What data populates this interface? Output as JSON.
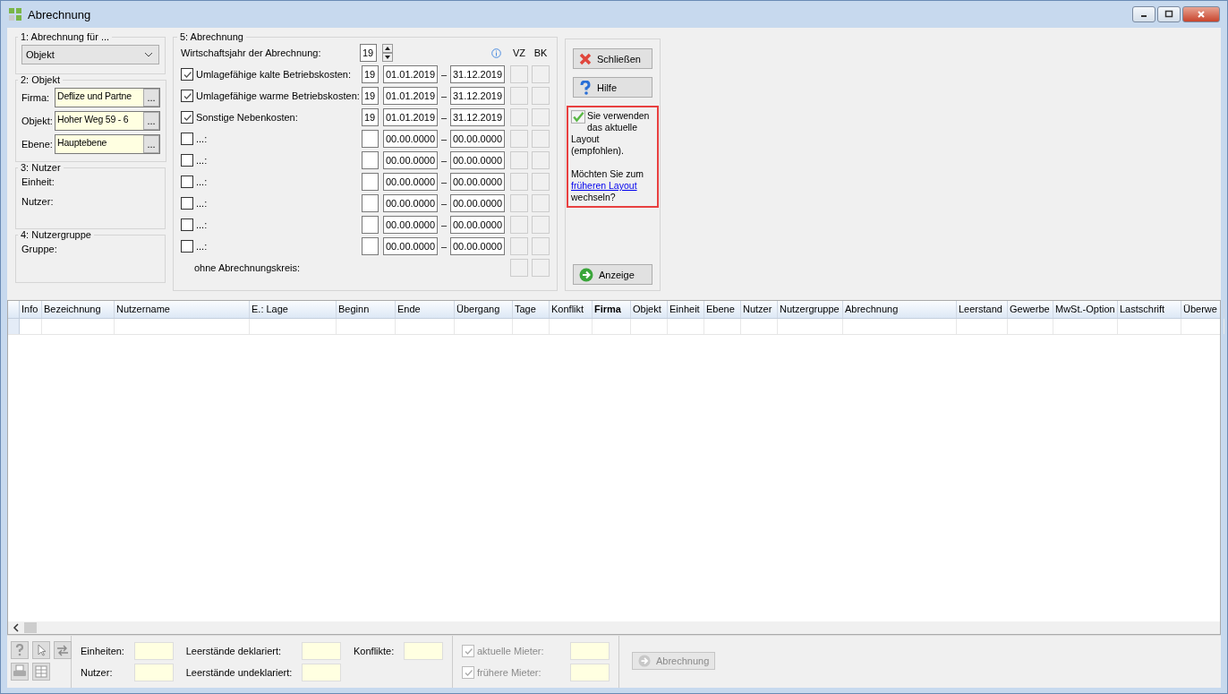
{
  "window": {
    "title": "Abrechnung"
  },
  "group1": {
    "title": "1: Abrechnung für ...",
    "select": "Objekt"
  },
  "group2": {
    "title": "2: Objekt",
    "fields": [
      {
        "label": "Firma:",
        "value": "Deflize und Partne",
        "browse": "..."
      },
      {
        "label": "Objekt:",
        "value": "Hoher Weg 59 - 6",
        "browse": "..."
      },
      {
        "label": "Ebene:",
        "value": "Hauptebene",
        "browse": "..."
      }
    ]
  },
  "group3": {
    "title": "3: Nutzer",
    "labels": [
      "Einheit:",
      "Nutzer:"
    ]
  },
  "group4": {
    "title": "4: Nutzergruppe",
    "labels": [
      "Gruppe:"
    ]
  },
  "group5": {
    "title": "5: Abrechnung",
    "year_label": "Wirtschaftsjahr der Abrechnung:",
    "year": "19",
    "vz": "VZ",
    "bk": "BK",
    "rows": [
      {
        "checked": true,
        "label": "Umlagefähige kalte Betriebskosten:",
        "year": "19",
        "from": "01.01.2019",
        "dash": "–",
        "to": "31.12.2019"
      },
      {
        "checked": true,
        "label": "Umlagefähige warme Betriebskosten:",
        "year": "19",
        "from": "01.01.2019",
        "dash": "–",
        "to": "31.12.2019"
      },
      {
        "checked": true,
        "label": "Sonstige Nebenkosten:",
        "year": "19",
        "from": "01.01.2019",
        "dash": "–",
        "to": "31.12.2019"
      },
      {
        "checked": false,
        "label": "...:",
        "from": "00.00.0000",
        "dash": "–",
        "to": "00.00.0000"
      },
      {
        "checked": false,
        "label": "...:",
        "from": "00.00.0000",
        "dash": "–",
        "to": "00.00.0000"
      },
      {
        "checked": false,
        "label": "...:",
        "from": "00.00.0000",
        "dash": "–",
        "to": "00.00.0000"
      },
      {
        "checked": false,
        "label": "...:",
        "from": "00.00.0000",
        "dash": "–",
        "to": "00.00.0000"
      },
      {
        "checked": false,
        "label": "...:",
        "from": "00.00.0000",
        "dash": "–",
        "to": "00.00.0000"
      },
      {
        "checked": false,
        "label": "...:",
        "from": "00.00.0000",
        "dash": "–",
        "to": "00.00.0000"
      }
    ],
    "without_label": "ohne Abrechnungskreis:"
  },
  "actions": {
    "close": "Schließen",
    "help": "Hilfe",
    "show": "Anzeige"
  },
  "notice": {
    "text1": "Sie verwenden das aktuelle Layout (empfohlen).",
    "text2": "Möchten Sie zum",
    "link": "früheren Layout",
    "text3": "wechseln?"
  },
  "table": {
    "columns": [
      {
        "label": "Info",
        "bold": false
      },
      {
        "label": "Bezeichnung",
        "bold": false
      },
      {
        "label": "Nutzername",
        "bold": false
      },
      {
        "label": "E.: Lage",
        "bold": false
      },
      {
        "label": "Beginn",
        "bold": false
      },
      {
        "label": "Ende",
        "bold": false
      },
      {
        "label": "Übergang",
        "bold": false
      },
      {
        "label": "Tage",
        "bold": false
      },
      {
        "label": "Konflikt",
        "bold": false
      },
      {
        "label": "Firma",
        "bold": true
      },
      {
        "label": "Objekt",
        "bold": false
      },
      {
        "label": "Einheit",
        "bold": false
      },
      {
        "label": "Ebene",
        "bold": false
      },
      {
        "label": "Nutzer",
        "bold": false
      },
      {
        "label": "Nutzergruppe",
        "bold": false
      },
      {
        "label": "Abrechnung",
        "bold": false
      },
      {
        "label": "Leerstand",
        "bold": false
      },
      {
        "label": "Gewerbe",
        "bold": false
      },
      {
        "label": "MwSt.-Option",
        "bold": false
      },
      {
        "label": "Lastschrift",
        "bold": false
      },
      {
        "label": "Überwe",
        "bold": false
      }
    ]
  },
  "status": {
    "stats": [
      {
        "label": "Einheiten:"
      },
      {
        "label": "Nutzer:"
      },
      {
        "label": "Leerstände deklariert:"
      },
      {
        "label": "Leerstände undeklariert:"
      },
      {
        "label": "Konflikte:"
      }
    ],
    "tenants": [
      {
        "label": "aktuelle Mieter:",
        "checked": true
      },
      {
        "label": "frühere Mieter:",
        "checked": true
      }
    ],
    "button": {
      "label": "Abrechnung",
      "disabled": true
    }
  }
}
